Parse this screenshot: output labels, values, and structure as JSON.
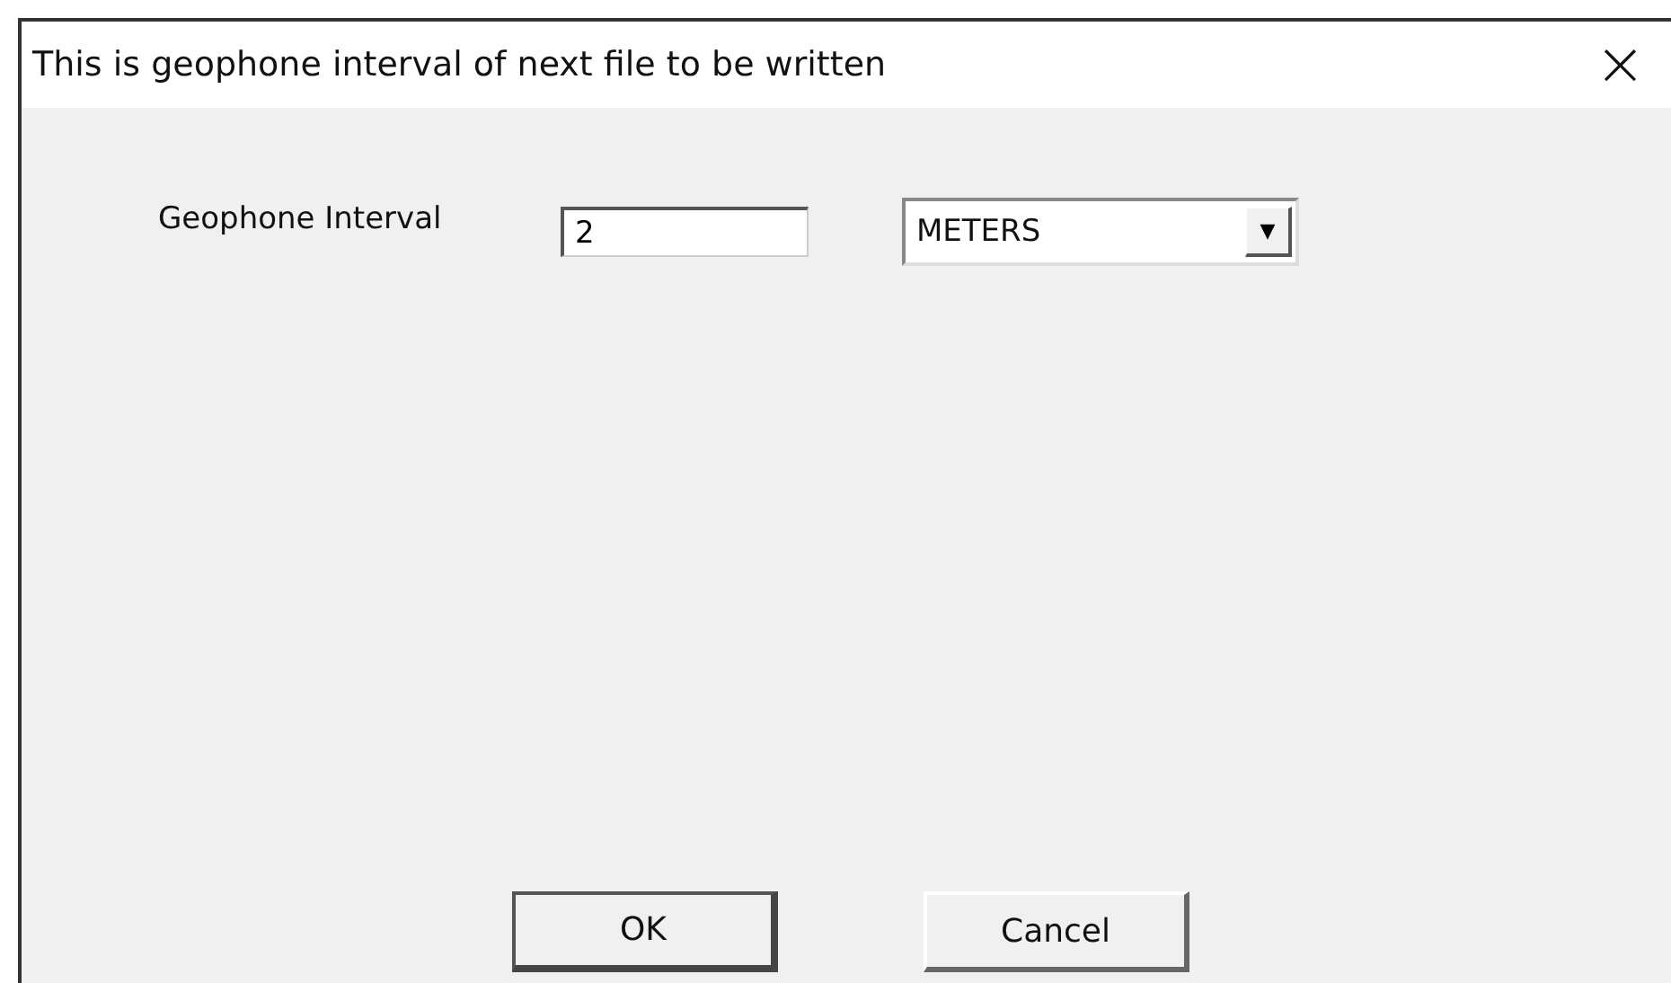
{
  "window": {
    "title": "This is geophone interval of next file to be written",
    "close": "×"
  },
  "form": {
    "label": "Geophone Interval",
    "value": "2",
    "unit": "METERS",
    "dropdown_arrow": "▼"
  },
  "buttons": [
    {
      "label": "OK",
      "default": true
    },
    {
      "label": "Cancel",
      "default": false
    }
  ]
}
